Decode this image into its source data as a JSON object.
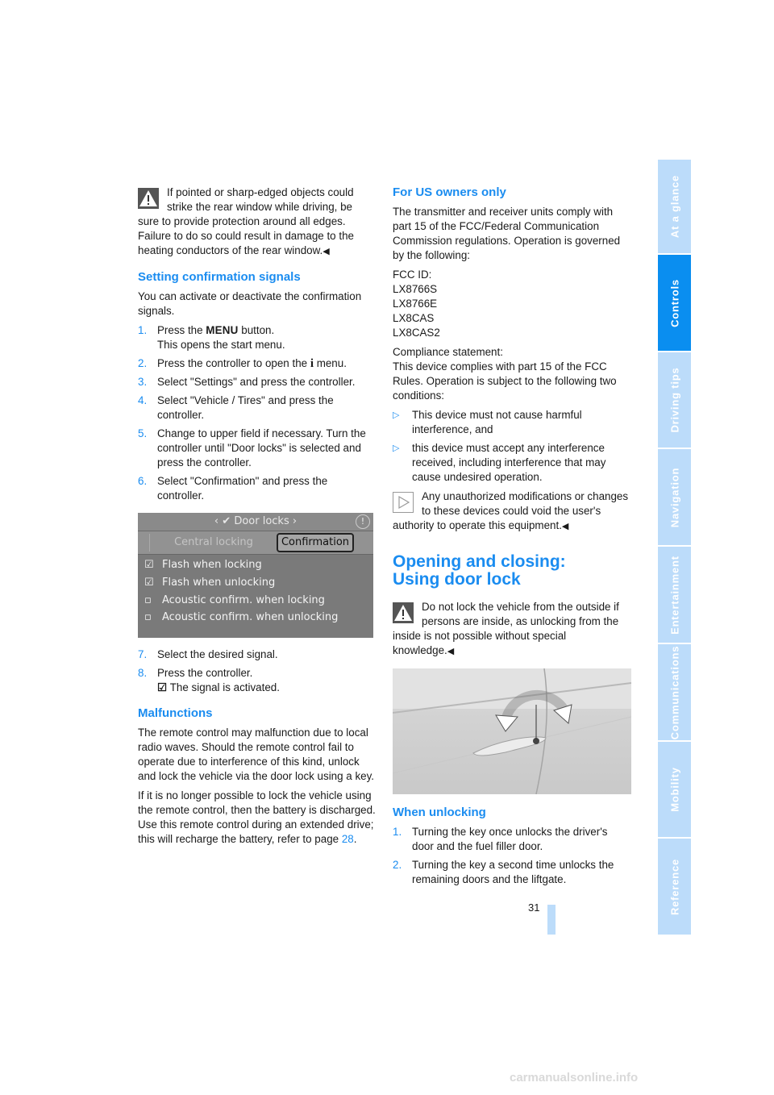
{
  "left": {
    "warning1": "If pointed or sharp-edged objects could strike the rear window while driving, be sure to provide protection around all edges. Failure to do so could result in damage to the heating conductors of the rear window.",
    "end_mark": "◀",
    "section_setting": {
      "title": "Setting confirmation signals",
      "intro": "You can activate or deactivate the confirmation signals.",
      "steps": [
        {
          "num": "1.",
          "pre": "Press the ",
          "button": "MENU",
          "post": " button.",
          "sub": "This opens the start menu."
        },
        {
          "num": "2.",
          "pre": "Press the controller to open the ",
          "icon": "i",
          "post": " menu."
        },
        {
          "num": "3.",
          "text": "Select \"Settings\" and press the controller."
        },
        {
          "num": "4.",
          "text": "Select \"Vehicle / Tires\" and press the controller."
        },
        {
          "num": "5.",
          "text": "Change to upper field if necessary. Turn the controller until \"Door locks\" is selected and press the controller."
        },
        {
          "num": "6.",
          "text": "Select \"Confirmation\" and press the controller."
        }
      ],
      "screen": {
        "title": "Door locks",
        "tab_inactive": "Central locking",
        "tab_active": "Confirmation",
        "options": [
          {
            "label": "Flash when locking",
            "checked": true
          },
          {
            "label": "Flash when unlocking",
            "checked": true
          },
          {
            "label": "Acoustic confirm. when locking",
            "checked": false
          },
          {
            "label": "Acoustic confirm. when unlocking",
            "checked": false
          }
        ]
      },
      "steps2": [
        {
          "num": "7.",
          "text": "Select the desired signal."
        },
        {
          "num": "8.",
          "text": "Press the controller.",
          "sub": "The signal is activated."
        }
      ]
    },
    "section_malfunctions": {
      "title": "Malfunctions",
      "p1": "The remote control may malfunction due to local radio waves. Should the remote control fail to operate due to interference of this kind, unlock and lock the vehicle via the door lock using a key.",
      "p2_pre": "If it is no longer possible to lock the vehicle using the remote control, then the battery is discharged. Use this remote control during an extended drive; this will recharge the battery, refer to page ",
      "p2_link": "28",
      "p2_post": "."
    }
  },
  "right": {
    "section_us": {
      "title": "For US owners only",
      "p1": "The transmitter and receiver units comply with part 15 of the FCC/Federal Communication Commission regulations. Operation is governed by the following:",
      "fcc_label": "FCC ID:",
      "fcc_ids": [
        "LX8766S",
        "LX8766E",
        "LX8CAS",
        "LX8CAS2"
      ],
      "compliance_label": "Compliance statement:",
      "compliance_text": "This device complies with part 15 of the FCC Rules. Operation is subject to the following two conditions:",
      "bullets": [
        "This device must not cause harmful interference, and",
        "this device must accept any interference received, including interference that may cause undesired operation."
      ],
      "note": "Any unauthorized modifications or changes to these devices could void the user's authority to operate this equipment."
    },
    "section_opening": {
      "title_line1": "Opening and closing:",
      "title_line2": "Using door lock",
      "warning": "Do not lock the vehicle from the outside if persons are inside, as unlocking from the inside is not possible without special knowledge."
    },
    "section_unlocking": {
      "title": "When unlocking",
      "steps": [
        {
          "num": "1.",
          "text": "Turning the key once unlocks the driver's door and the fuel filler door."
        },
        {
          "num": "2.",
          "text": "Turning the key a second time unlocks the remaining doors and the liftgate."
        }
      ]
    }
  },
  "sidebar": {
    "tabs": [
      {
        "label": "At a glance",
        "active": false
      },
      {
        "label": "Controls",
        "active": true
      },
      {
        "label": "Driving tips",
        "active": false
      },
      {
        "label": "Navigation",
        "active": false
      },
      {
        "label": "Entertainment",
        "active": false
      },
      {
        "label": "Communications",
        "active": false
      },
      {
        "label": "Mobility",
        "active": false
      },
      {
        "label": "Reference",
        "active": false
      }
    ]
  },
  "page_number": "31",
  "footer": "carmanualsonline.info",
  "colors": {
    "accent": "#1a8cf0",
    "tab_inactive": "#bcdcfa",
    "tab_active": "#0a8ef0"
  }
}
